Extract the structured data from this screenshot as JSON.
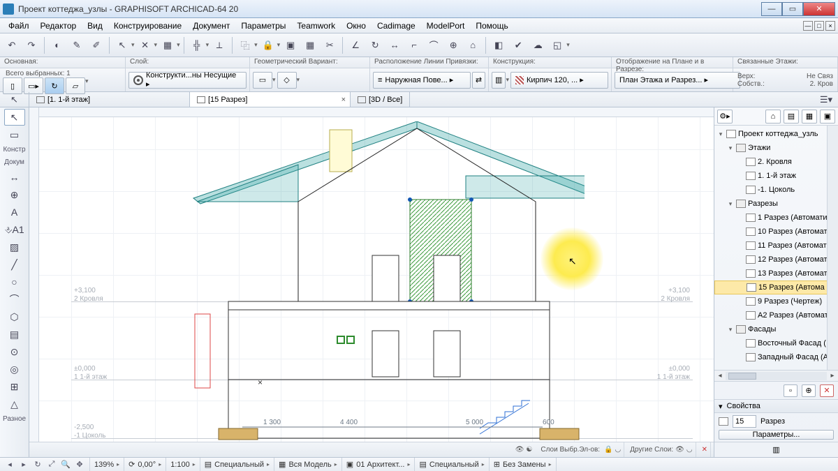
{
  "title": "Проект коттеджа_узлы - GRAPHISOFT ARCHICAD-64 20",
  "menu": [
    "Файл",
    "Редактор",
    "Вид",
    "Конструирование",
    "Документ",
    "Параметры",
    "Teamwork",
    "Окно",
    "Cadimage",
    "ModelPort",
    "Помощь"
  ],
  "info_labels": {
    "c0": "Основная:",
    "c1": "Слой:",
    "c2": "Геометрический Вариант:",
    "c3": "Расположение Линии Привязки:",
    "c4": "Конструкция:",
    "c5": "Отображение на Плане и в Разрезе:",
    "c6": "Связанные Этажи:"
  },
  "sel_count": "Всего выбранных: 1",
  "info_values": {
    "layer": "Конструкти...ны Несущие ▸",
    "snapline": "Наружная Пове... ▸",
    "construction": "Кирпич 120, ... ▸",
    "plan_section": "План Этажа и Разрез... ▸",
    "link_top_l": "Верх:",
    "link_top_r": "Не Связ",
    "link_bot_l": "Собств.:",
    "link_bot_r": "2. Кров"
  },
  "tabs": [
    {
      "label": "[1. 1-й этаж]"
    },
    {
      "label": "[15 Разрез]",
      "active": true
    },
    {
      "label": "[3D / Все]"
    }
  ],
  "toolbox_labels": {
    "konstr": "Констр",
    "dokum": "Докум",
    "razno": "Разное"
  },
  "levels": {
    "l1": {
      "h": "+3,100",
      "n": "2 Кровля"
    },
    "l2": {
      "h": "±0,000",
      "n": "1 1-й этаж"
    },
    "l3": {
      "h": "-2,500",
      "n": "-1 Цоколь"
    }
  },
  "dims": {
    "d1": "1 300",
    "d2": "4 400",
    "d3": "5 000",
    "d4": "600"
  },
  "tree": [
    {
      "lvl": 0,
      "exp": "▾",
      "icon": "h",
      "label": "Проект коттеджа_узль"
    },
    {
      "lvl": 1,
      "exp": "▾",
      "icon": "f",
      "label": "Этажи"
    },
    {
      "lvl": 2,
      "exp": "",
      "icon": "p",
      "label": "2. Кровля"
    },
    {
      "lvl": 2,
      "exp": "",
      "icon": "p",
      "label": "1. 1-й этаж"
    },
    {
      "lvl": 2,
      "exp": "",
      "icon": "p",
      "label": "-1. Цоколь"
    },
    {
      "lvl": 1,
      "exp": "▾",
      "icon": "f",
      "label": "Разрезы"
    },
    {
      "lvl": 2,
      "exp": "",
      "icon": "s",
      "label": "1 Разрез (Автомати"
    },
    {
      "lvl": 2,
      "exp": "",
      "icon": "s",
      "label": "10 Разрез (Автомат"
    },
    {
      "lvl": 2,
      "exp": "",
      "icon": "s",
      "label": "11 Разрез (Автомат"
    },
    {
      "lvl": 2,
      "exp": "",
      "icon": "s",
      "label": "12 Разрез (Автомат"
    },
    {
      "lvl": 2,
      "exp": "",
      "icon": "s",
      "label": "13 Разрез (Автомат"
    },
    {
      "lvl": 2,
      "exp": "",
      "icon": "s",
      "label": "15 Разрез (Автома",
      "sel": true
    },
    {
      "lvl": 2,
      "exp": "",
      "icon": "s",
      "label": "9 Разрез (Чертеж)"
    },
    {
      "lvl": 2,
      "exp": "",
      "icon": "s",
      "label": "A2 Разрез (Автомат"
    },
    {
      "lvl": 1,
      "exp": "▾",
      "icon": "f",
      "label": "Фасады"
    },
    {
      "lvl": 2,
      "exp": "",
      "icon": "s",
      "label": "Восточный Фасад ("
    },
    {
      "lvl": 2,
      "exp": "",
      "icon": "s",
      "label": "Западный Фасад (А"
    }
  ],
  "props": {
    "title": "Свойства",
    "id": "15",
    "name": "Разрез",
    "params_btn": "Параметры..."
  },
  "quick": {
    "sel_layers": "Слои Выбр.Эл-ов:",
    "other_layers": "Другие Слои:"
  },
  "status": {
    "zoom": "139%",
    "coord": "0,00°",
    "scale": "1:100",
    "s1": "Специальный",
    "s2": "Вся Модель",
    "s3": "01 Архитект...",
    "s4": "Специальный",
    "s5": "Без Замены"
  }
}
